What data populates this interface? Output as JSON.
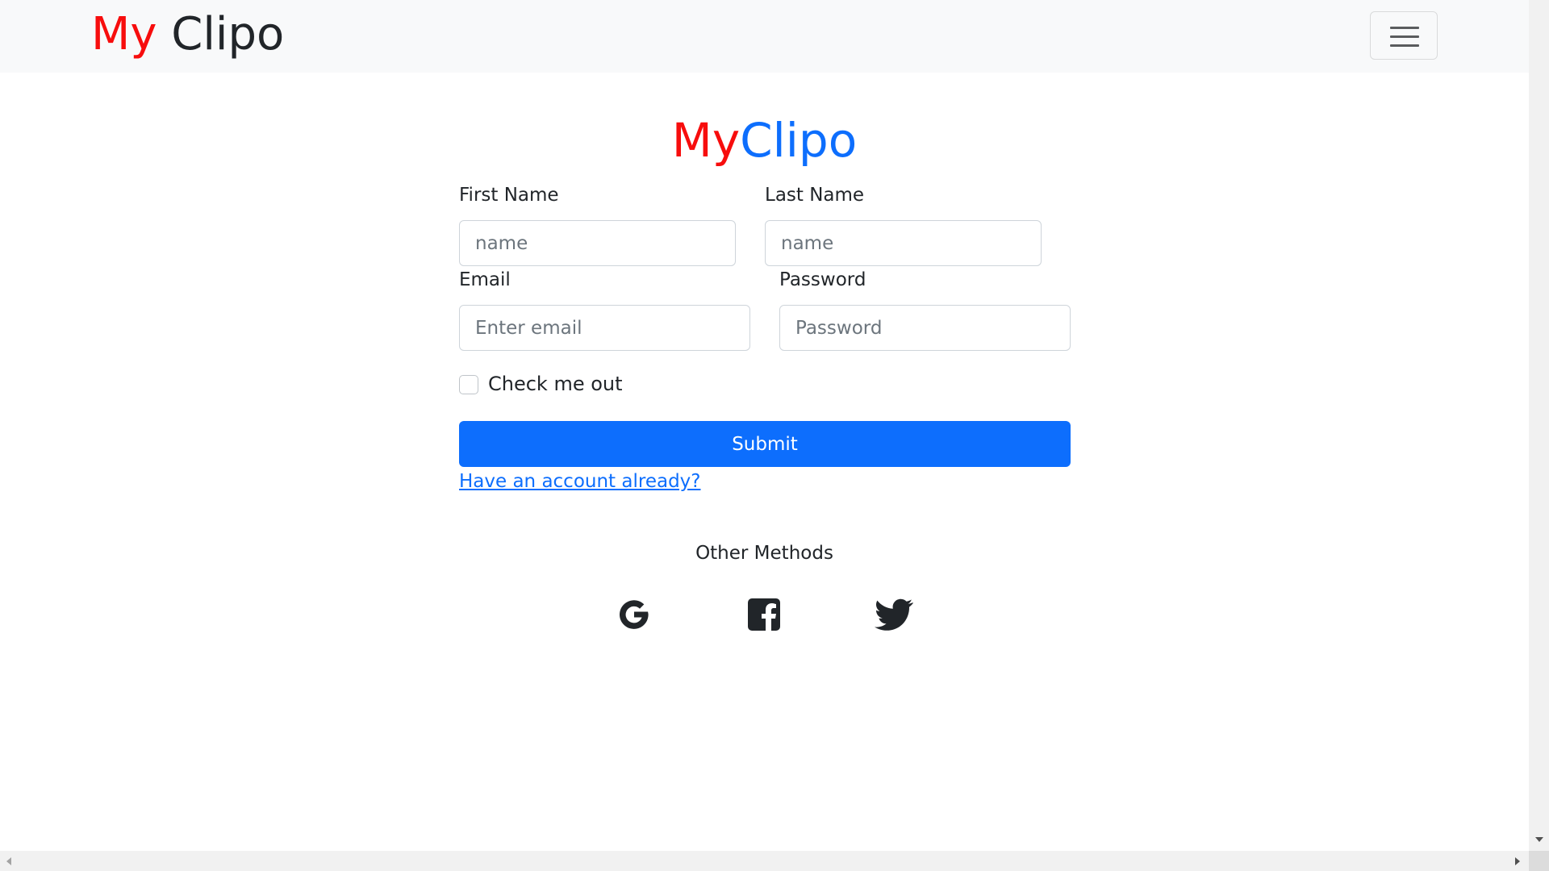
{
  "navbar": {
    "brand_part1": "My",
    "brand_part2": " Clipo",
    "toggler_icon": "hamburger-menu-icon"
  },
  "form": {
    "title_part1": "My",
    "title_part2": "Clipo",
    "first_name": {
      "label": "First Name",
      "placeholder": "name",
      "value": ""
    },
    "last_name": {
      "label": "Last Name",
      "placeholder": "name",
      "value": ""
    },
    "email": {
      "label": "Email",
      "placeholder": "Enter email",
      "value": ""
    },
    "password": {
      "label": "Password",
      "placeholder": "Password",
      "value": ""
    },
    "checkbox": {
      "label": "Check me out",
      "checked": false
    },
    "submit_label": "Submit",
    "login_link": "Have an account already?"
  },
  "other_methods": {
    "heading": "Other Methods",
    "icons": [
      "google-icon",
      "facebook-icon",
      "twitter-icon"
    ]
  },
  "colors": {
    "brand_red": "#f70d0d",
    "brand_blue": "#0d6efd",
    "button_blue": "#0d6efd",
    "navbar_bg": "#f8f9fa"
  }
}
